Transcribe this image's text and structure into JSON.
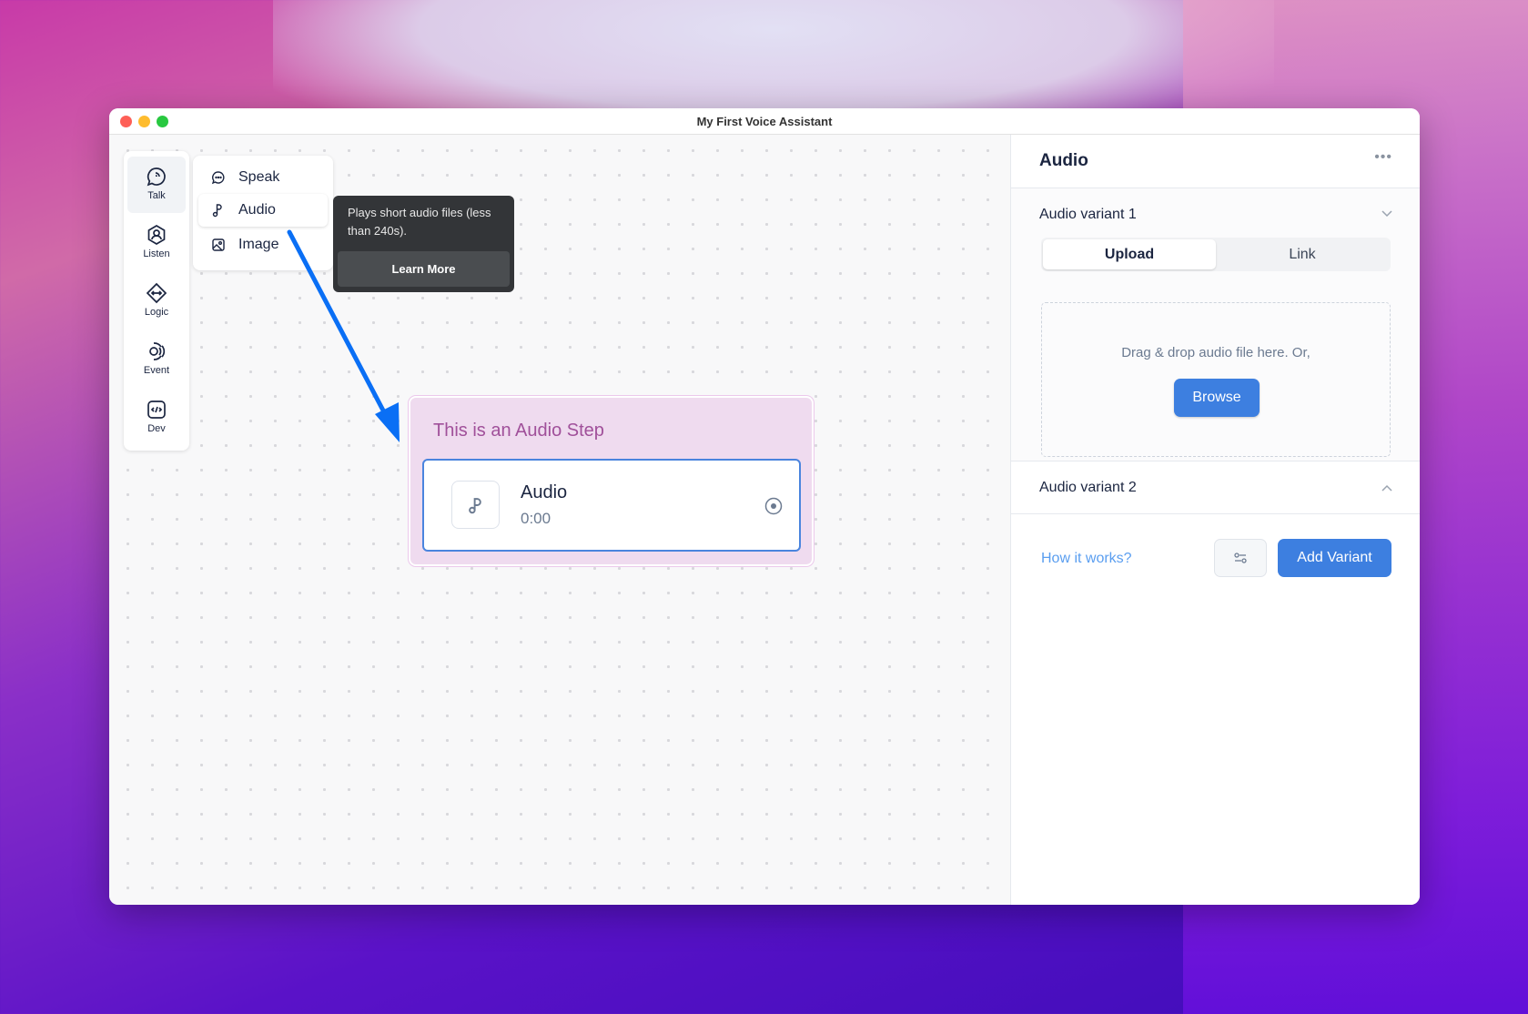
{
  "window": {
    "title": "My First Voice Assistant"
  },
  "sidebar": {
    "items": [
      {
        "label": "Talk",
        "icon": "talk-icon",
        "active": true
      },
      {
        "label": "Listen",
        "icon": "listen-icon"
      },
      {
        "label": "Logic",
        "icon": "logic-icon"
      },
      {
        "label": "Event",
        "icon": "event-icon"
      },
      {
        "label": "Dev",
        "icon": "dev-icon"
      }
    ]
  },
  "menu": {
    "items": [
      {
        "label": "Speak",
        "icon": "speech-bubble-icon"
      },
      {
        "label": "Audio",
        "icon": "music-note-icon",
        "active": true
      },
      {
        "label": "Image",
        "icon": "image-icon"
      }
    ]
  },
  "tooltip": {
    "text": "Plays short audio files (less than 240s).",
    "button": "Learn More"
  },
  "step": {
    "title": "This is an Audio Step",
    "card": {
      "title": "Audio",
      "duration": "0:00"
    }
  },
  "panel": {
    "title": "Audio",
    "more": "•••",
    "variant1": {
      "title": "Audio variant 1",
      "tabs": [
        "Upload",
        "Link"
      ],
      "active_tab": "Upload",
      "drop_text": "Drag & drop audio file here. Or,",
      "browse": "Browse"
    },
    "variant2": {
      "title": "Audio variant 2"
    },
    "how_link": "How it works?",
    "add_variant": "Add Variant"
  },
  "colors": {
    "accent": "#3d7fe0",
    "step_bg": "#efdbef",
    "step_title": "#a0509a",
    "arrow": "#0a6ff5"
  }
}
